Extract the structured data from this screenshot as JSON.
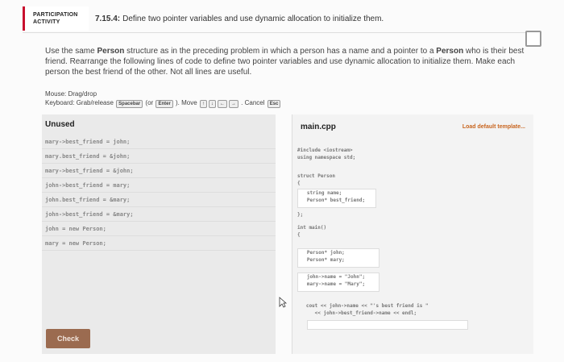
{
  "header": {
    "badge_line1": "PARTICIPATION",
    "badge_line2": "ACTIVITY",
    "number": "7.15.4:",
    "title": "Define two pointer variables and use dynamic allocation to initialize them."
  },
  "description": {
    "text1": "Use the same ",
    "type1": "Person",
    "text2": " structure as in the preceding problem in which a person has a name and a pointer to a ",
    "type2": "Person",
    "text3": " who is their best friend. Rearrange the following lines of code to define two pointer variables and use dynamic allocation to initialize them. Make each person the best friend of the other. Not all lines are useful."
  },
  "hints": {
    "mouse": "Mouse: Drag/drop",
    "keyboard_prefix": "Keyboard: Grab/release",
    "key_spacebar": "Spacebar",
    "or_text": "(or",
    "key_enter": "Enter",
    "move_text": "). Move",
    "arrow_keys": [
      "↑",
      "↓",
      "←",
      "→"
    ],
    "cancel_text": ". Cancel",
    "key_esc": "Esc"
  },
  "unused": {
    "title": "Unused",
    "items": [
      "mary->best_friend = john;",
      "mary.best_friend = &john;",
      "mary->best_friend = &john;",
      "john->best_friend = mary;",
      "john.best_friend = &mary;",
      "john->best_friend = &mary;",
      "john = new Person;",
      "mary = new Person;"
    ],
    "check_label": "Check"
  },
  "main": {
    "filename": "main.cpp",
    "load_default": "Load default template...",
    "code_block1": "#include <iostream>\nusing namespace std;",
    "code_block2": "struct Person\n{",
    "code_block3": "   string name;\n   Person* best_friend;",
    "code_block4": "};",
    "code_block5": "int main()\n{",
    "code_block6": "   Person* john;\n   Person* mary;",
    "code_block7": "   john->name = \"John\";\n   mary->name = \"Mary\";",
    "code_block8": "   cout << john->name << \"'s best friend is \"\n      << john->best_friend->name << endl;"
  }
}
